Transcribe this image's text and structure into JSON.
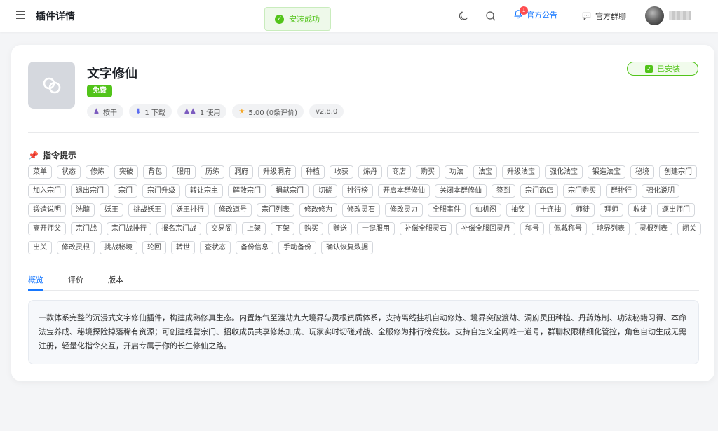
{
  "header": {
    "title": "插件详情",
    "toast": "安装成功",
    "notice_label": "官方公告",
    "notice_badge": "1",
    "group_label": "官方群聊"
  },
  "plugin": {
    "name": "文字修仙",
    "price_tag": "免费",
    "author": "桉干",
    "downloads": "1 下载",
    "uses": "1 使用",
    "rating": "5.00 (0条评价)",
    "version": "v2.8.0",
    "status": "已安装"
  },
  "commands": {
    "title": "指令提示",
    "items": [
      "菜单",
      "状态",
      "修炼",
      "突破",
      "背包",
      "服用",
      "历练",
      "洞府",
      "升级洞府",
      "种植",
      "收获",
      "炼丹",
      "商店",
      "购买",
      "功法",
      "法宝",
      "升级法宝",
      "强化法宝",
      "锻造法宝",
      "秘境",
      "创建宗门",
      "加入宗门",
      "退出宗门",
      "宗门",
      "宗门升级",
      "转让宗主",
      "解散宗门",
      "捐献宗门",
      "切磋",
      "排行榜",
      "开启本群修仙",
      "关闭本群修仙",
      "签到",
      "宗门商店",
      "宗门购买",
      "群排行",
      "强化说明",
      "锻造说明",
      "洗髓",
      "妖王",
      "挑战妖王",
      "妖王排行",
      "修改道号",
      "宗门列表",
      "修改修为",
      "修改灵石",
      "修改灵力",
      "全服事件",
      "仙机阁",
      "抽奖",
      "十连抽",
      "师徒",
      "拜师",
      "收徒",
      "逐出师门",
      "离开师父",
      "宗门战",
      "宗门战排行",
      "报名宗门战",
      "交易阁",
      "上架",
      "下架",
      "购买",
      "赠送",
      "一键服用",
      "补偿全服灵石",
      "补偿全服回灵丹",
      "称号",
      "佩戴称号",
      "境界列表",
      "灵根列表",
      "闭关",
      "出关",
      "修改灵根",
      "挑战秘境",
      "轮回",
      "转世",
      "查状态",
      "备份信息",
      "手动备份",
      "确认恢复数据"
    ]
  },
  "tabs": [
    "概览",
    "评价",
    "版本"
  ],
  "description": "一款体系完整的沉浸式文字修仙插件，构建成熟修真生态。内置炼气至渡劫九大境界与灵根资质体系，支持离线挂机自动修炼、境界突破渡劫、洞府灵田种植、丹药炼制、功法秘籍习得、本命法宝养成、秘境探险掉落稀有资源；可创建经营宗门、招收成员共享修炼加成、玩家实时切磋对战、全服修为排行榜竞技。支持自定义全网唯一道号，群聊权限精细化管控，角色自动生成无需注册，轻量化指令交互，开启专属于你的长生修仙之路。",
  "colors": {
    "primary": "#1677ff",
    "success": "#52c41a",
    "badge": "#ff4d4f"
  }
}
